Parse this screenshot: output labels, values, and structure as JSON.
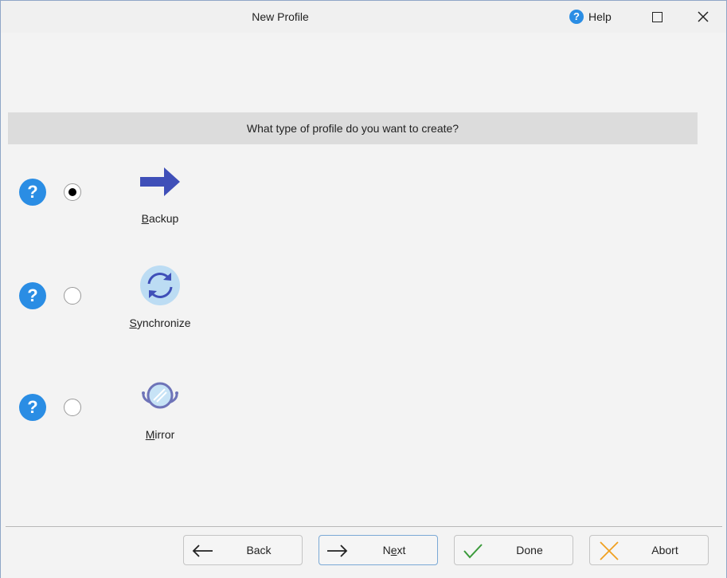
{
  "window": {
    "title": "New Profile",
    "help_label": "Help",
    "help_icon": "question-mark-icon"
  },
  "question": "What type of profile do you want to create?",
  "options": [
    {
      "label_first": "B",
      "label_rest": "ackup",
      "icon": "arrow-right-icon",
      "selected": true
    },
    {
      "label_first": "S",
      "label_rest": "ynchronize",
      "icon": "sync-icon",
      "selected": false
    },
    {
      "label_first": "M",
      "label_rest": "irror",
      "icon": "mirror-icon",
      "selected": false
    }
  ],
  "buttons": {
    "back": {
      "label": "Back",
      "icon": "arrow-left-icon"
    },
    "next": {
      "label_pre": "N",
      "label_ul": "e",
      "label_post": "xt",
      "icon": "arrow-right-icon"
    },
    "done": {
      "label": "Done",
      "icon": "checkmark-icon"
    },
    "abort": {
      "label": "Abort",
      "icon": "x-icon"
    }
  },
  "colors": {
    "accent_blue": "#2a8de4",
    "arrow_blue": "#3f4fb8",
    "check_green": "#3a9a3a",
    "abort_orange": "#f0a020"
  }
}
